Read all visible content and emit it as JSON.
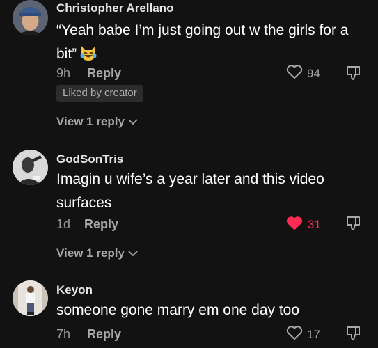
{
  "comments": [
    {
      "username": "Christopher Arellano",
      "text": "“Yeah babe I’m just going out w the girls for a bit”",
      "emoji": "laughing-tears-cat-emoji",
      "time": "9h",
      "reply_label": "Reply",
      "likes": "94",
      "liked": false,
      "badge": "Liked by creator",
      "view_replies": "View 1 reply"
    },
    {
      "username": "GodSonTris",
      "text": "Imagin u wife’s a year later and this video surfaces",
      "time": "1d",
      "reply_label": "Reply",
      "likes": "31",
      "liked": true,
      "view_replies": "View 1 reply"
    },
    {
      "username": "Keyon",
      "text": "someone gone marry em one day too",
      "time": "7h",
      "reply_label": "Reply",
      "likes": "17",
      "liked": false
    }
  ],
  "colors": {
    "background": "#121212",
    "like_active": "#fe2c55",
    "secondary_text": "#a8a8a8"
  }
}
